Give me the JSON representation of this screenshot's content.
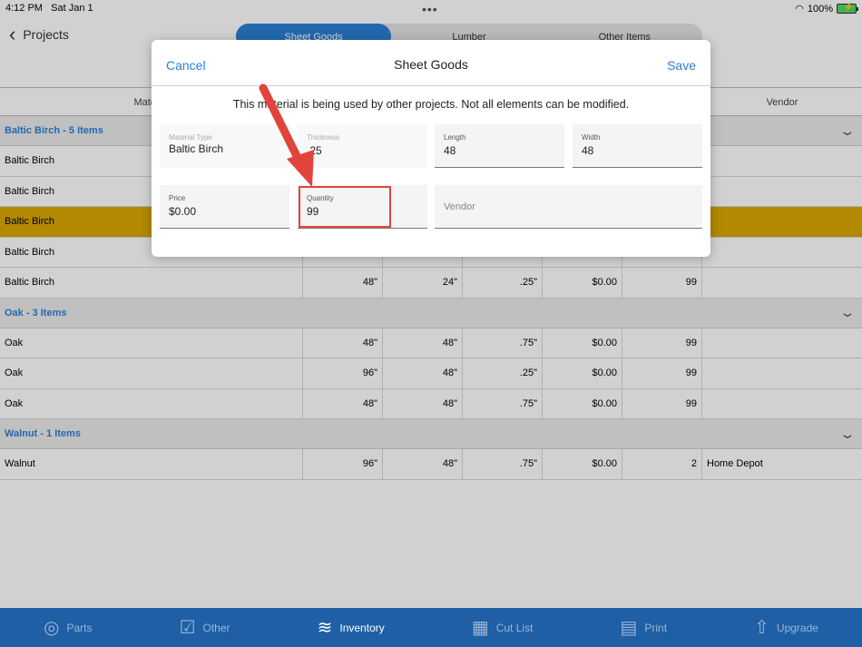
{
  "status": {
    "time": "4:12 PM",
    "date": "Sat Jan 1",
    "battery": "100%"
  },
  "nav": {
    "back_label": "Projects",
    "segments": [
      "Sheet Goods",
      "Lumber",
      "Other Items"
    ]
  },
  "table": {
    "headers": {
      "material": "Material",
      "vendor": "Vendor"
    },
    "groups": [
      {
        "label": "Baltic Birch - 5 Items",
        "rows": [
          [
            "Baltic Birch",
            "",
            "",
            "",
            "",
            "",
            ""
          ],
          [
            "Baltic Birch",
            "",
            "",
            "",
            "",
            "",
            ""
          ],
          [
            "Baltic Birch",
            "",
            "",
            "",
            "",
            "",
            ""
          ],
          [
            "Baltic Birch",
            "",
            "",
            "",
            "",
            "",
            ""
          ],
          [
            "Baltic Birch",
            "48\"",
            "24\"",
            ".25\"",
            "$0.00",
            "99",
            ""
          ]
        ]
      },
      {
        "label": "Oak - 3 Items",
        "rows": [
          [
            "Oak",
            "48\"",
            "48\"",
            ".75\"",
            "$0.00",
            "99",
            ""
          ],
          [
            "Oak",
            "96\"",
            "48\"",
            ".25\"",
            "$0.00",
            "99",
            ""
          ],
          [
            "Oak",
            "48\"",
            "48\"",
            ".75\"",
            "$0.00",
            "99",
            ""
          ]
        ]
      },
      {
        "label": "Walnut - 1 Items",
        "rows": [
          [
            "Walnut",
            "96\"",
            "48\"",
            ".75\"",
            "$0.00",
            "2",
            "Home Depot"
          ]
        ]
      }
    ]
  },
  "modal": {
    "cancel": "Cancel",
    "title": "Sheet Goods",
    "save": "Save",
    "warning": "This material is being used by other projects.  Not all elements can be modified.",
    "material_type": {
      "label": "Material Type",
      "value": "Baltic Birch"
    },
    "thickness": {
      "label": "Thickness",
      "value": ".25"
    },
    "length": {
      "label": "Length",
      "value": "48"
    },
    "width": {
      "label": "Width",
      "value": "48"
    },
    "price": {
      "label": "Price",
      "value": "$0.00"
    },
    "quantity": {
      "label": "Quantity",
      "value": "99"
    },
    "vendor": {
      "placeholder": "Vendor"
    }
  },
  "tabbar": [
    "Parts",
    "Other",
    "Inventory",
    "Cut List",
    "Print",
    "Upgrade"
  ],
  "colors": {
    "accent": "#2b7fd6",
    "selected_row": "#d9a800",
    "tabbar": "#1e5fa6",
    "annotation": "#e0443c"
  }
}
